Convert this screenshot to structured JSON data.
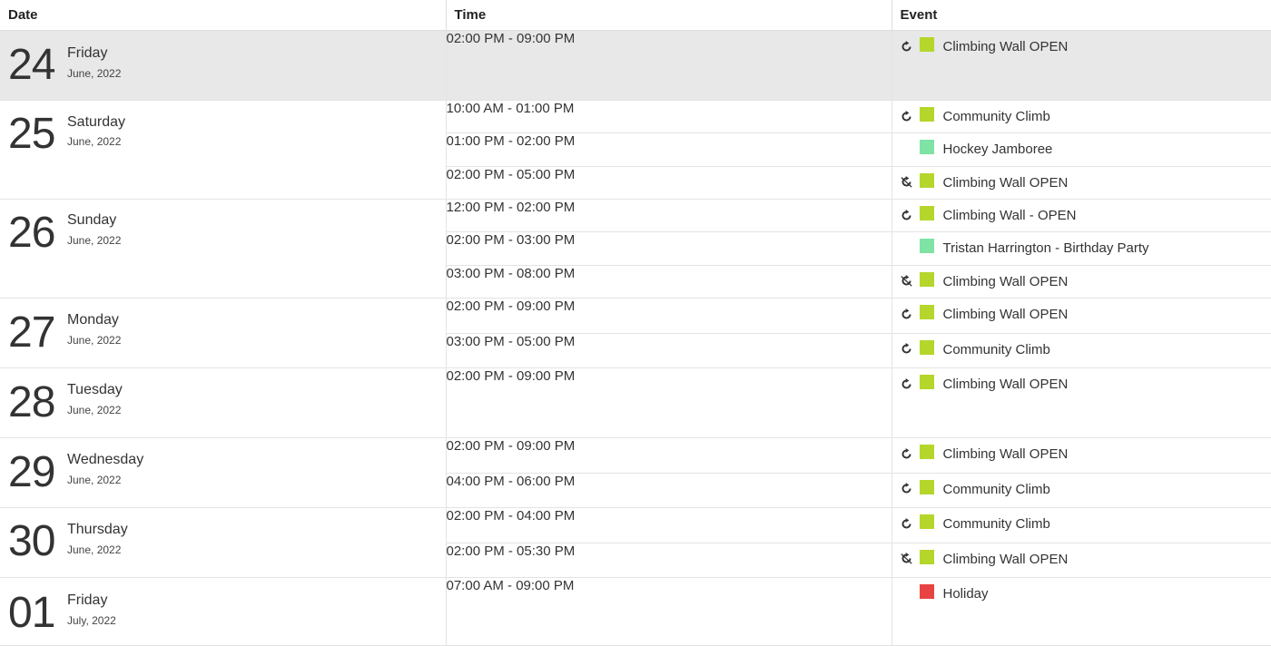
{
  "headers": {
    "date": "Date",
    "time": "Time",
    "event": "Event"
  },
  "colors": {
    "climbing": "#b5d62a",
    "community": "#b5d62a",
    "hockey": "#7ee3a4",
    "party": "#7ee3a4",
    "holiday": "#e84343"
  },
  "days": [
    {
      "num": "24",
      "name": "Friday",
      "month": "June, 2022",
      "today": true,
      "events": [
        {
          "time": "02:00 PM - 09:00 PM",
          "title": "Climbing Wall OPEN",
          "icon": "recurring-icon",
          "color": "#b5d62a"
        }
      ]
    },
    {
      "num": "25",
      "name": "Saturday",
      "month": "June, 2022",
      "events": [
        {
          "time": "10:00 AM - 01:00 PM",
          "title": "Community Climb",
          "icon": "recurring-icon",
          "color": "#b5d62a"
        },
        {
          "time": "01:00 PM - 02:00 PM",
          "title": "Hockey Jamboree",
          "icon": "",
          "color": "#7ee3a4"
        },
        {
          "time": "02:00 PM - 05:00 PM",
          "title": "Climbing Wall OPEN",
          "icon": "recurring-off-icon",
          "color": "#b5d62a"
        }
      ]
    },
    {
      "num": "26",
      "name": "Sunday",
      "month": "June, 2022",
      "events": [
        {
          "time": "12:00 PM - 02:00 PM",
          "title": "Climbing Wall - OPEN",
          "icon": "recurring-icon",
          "color": "#b5d62a"
        },
        {
          "time": "02:00 PM - 03:00 PM",
          "title": "Tristan Harrington - Birthday Party",
          "icon": "",
          "color": "#7ee3a4"
        },
        {
          "time": "03:00 PM - 08:00 PM",
          "title": "Climbing Wall OPEN",
          "icon": "recurring-off-icon",
          "color": "#b5d62a"
        }
      ]
    },
    {
      "num": "27",
      "name": "Monday",
      "month": "June, 2022",
      "events": [
        {
          "time": "02:00 PM - 09:00 PM",
          "title": "Climbing Wall OPEN",
          "icon": "recurring-icon",
          "color": "#b5d62a"
        },
        {
          "time": "03:00 PM - 05:00 PM",
          "title": "Community Climb",
          "icon": "recurring-icon",
          "color": "#b5d62a"
        }
      ]
    },
    {
      "num": "28",
      "name": "Tuesday",
      "month": "June, 2022",
      "events": [
        {
          "time": "02:00 PM - 09:00 PM",
          "title": "Climbing Wall OPEN",
          "icon": "recurring-icon",
          "color": "#b5d62a"
        }
      ]
    },
    {
      "num": "29",
      "name": "Wednesday",
      "month": "June, 2022",
      "events": [
        {
          "time": "02:00 PM - 09:00 PM",
          "title": "Climbing Wall OPEN",
          "icon": "recurring-icon",
          "color": "#b5d62a"
        },
        {
          "time": "04:00 PM - 06:00 PM",
          "title": "Community Climb",
          "icon": "recurring-icon",
          "color": "#b5d62a"
        }
      ]
    },
    {
      "num": "30",
      "name": "Thursday",
      "month": "June, 2022",
      "events": [
        {
          "time": "02:00 PM - 04:00 PM",
          "title": "Community Climb",
          "icon": "recurring-icon",
          "color": "#b5d62a"
        },
        {
          "time": "02:00 PM - 05:30 PM",
          "title": "Climbing Wall OPEN",
          "icon": "recurring-off-icon",
          "color": "#b5d62a"
        }
      ]
    },
    {
      "num": "01",
      "name": "Friday",
      "month": "July, 2022",
      "events": [
        {
          "time": "07:00 AM - 09:00 PM",
          "title": "Holiday",
          "icon": "",
          "color": "#e84343"
        }
      ]
    }
  ]
}
